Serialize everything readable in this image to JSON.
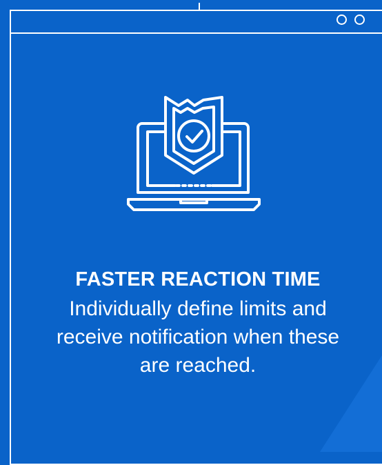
{
  "colors": {
    "background": "#0a63c9",
    "accent": "#ffffff"
  },
  "window": {
    "controls": [
      "circle-icon",
      "circle-icon"
    ]
  },
  "feature": {
    "icon": "laptop-shield-check-icon",
    "heading": "FASTER REACTION TIME",
    "description": "Individually define limits and receive notification when these are reached."
  }
}
